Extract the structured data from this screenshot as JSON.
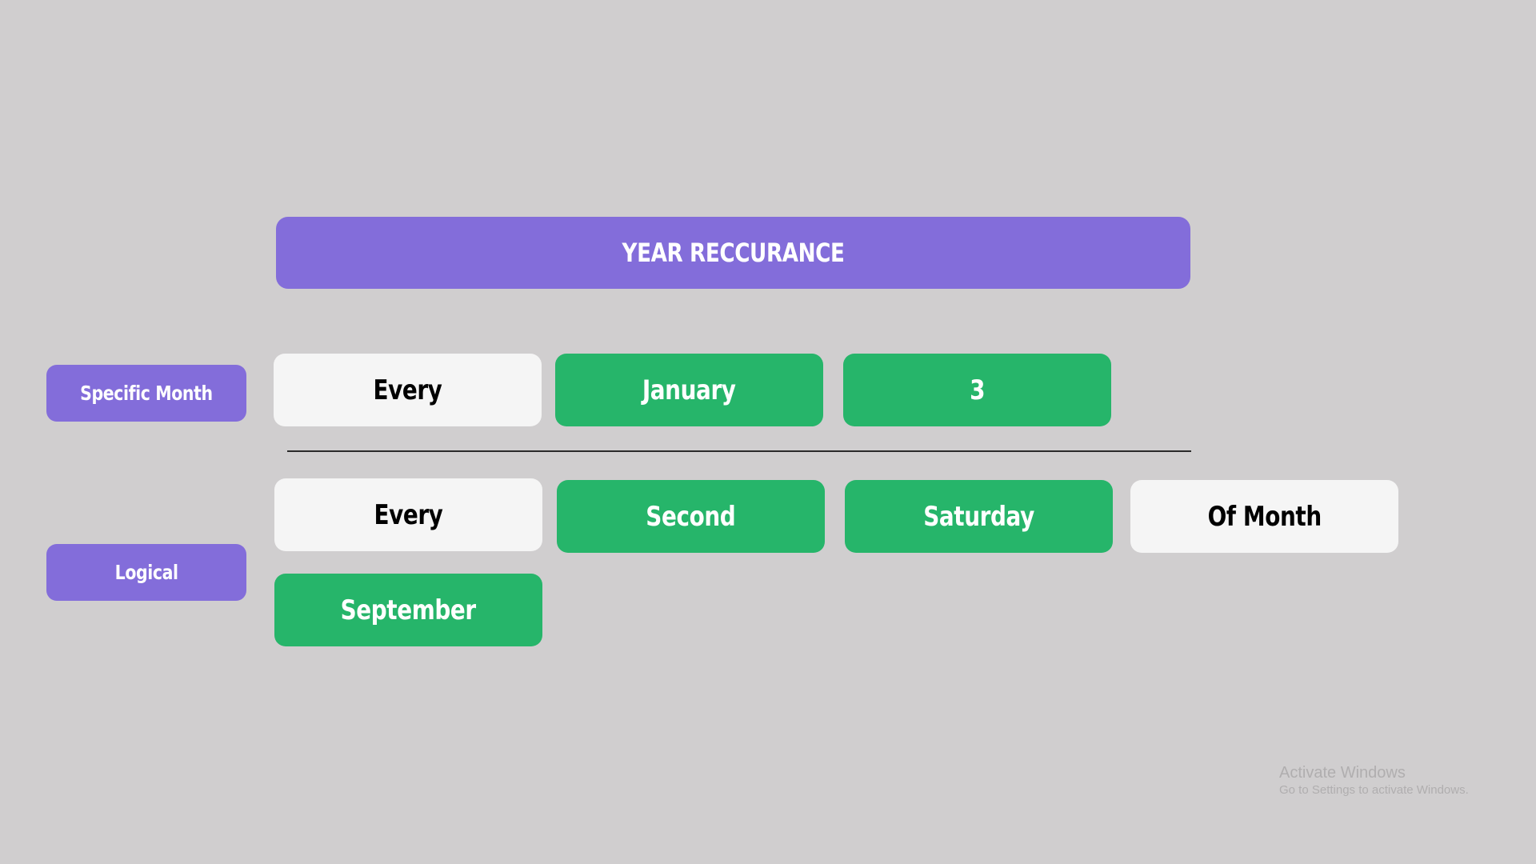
{
  "header": {
    "title": "YEAR RECCURANCE"
  },
  "rows": {
    "specific": {
      "label": "Specific Month",
      "options": [
        {
          "text": "Every",
          "state": "unselected"
        },
        {
          "text": "January",
          "state": "selected"
        },
        {
          "text": "3",
          "state": "selected"
        }
      ]
    },
    "logical": {
      "label": "Logical",
      "options": [
        {
          "text": "Every",
          "state": "unselected"
        },
        {
          "text": "Second",
          "state": "selected"
        },
        {
          "text": "Saturday",
          "state": "selected"
        },
        {
          "text": "Of Month",
          "state": "unselected"
        },
        {
          "text": "September",
          "state": "selected"
        }
      ]
    }
  },
  "colors": {
    "background": "#d0cecf",
    "accent_purple": "#836dda",
    "selected_green": "#26b56a",
    "unselected_white": "#f5f5f5"
  },
  "watermark": {
    "title": "Activate Windows",
    "subtitle": "Go to Settings to activate Windows."
  }
}
